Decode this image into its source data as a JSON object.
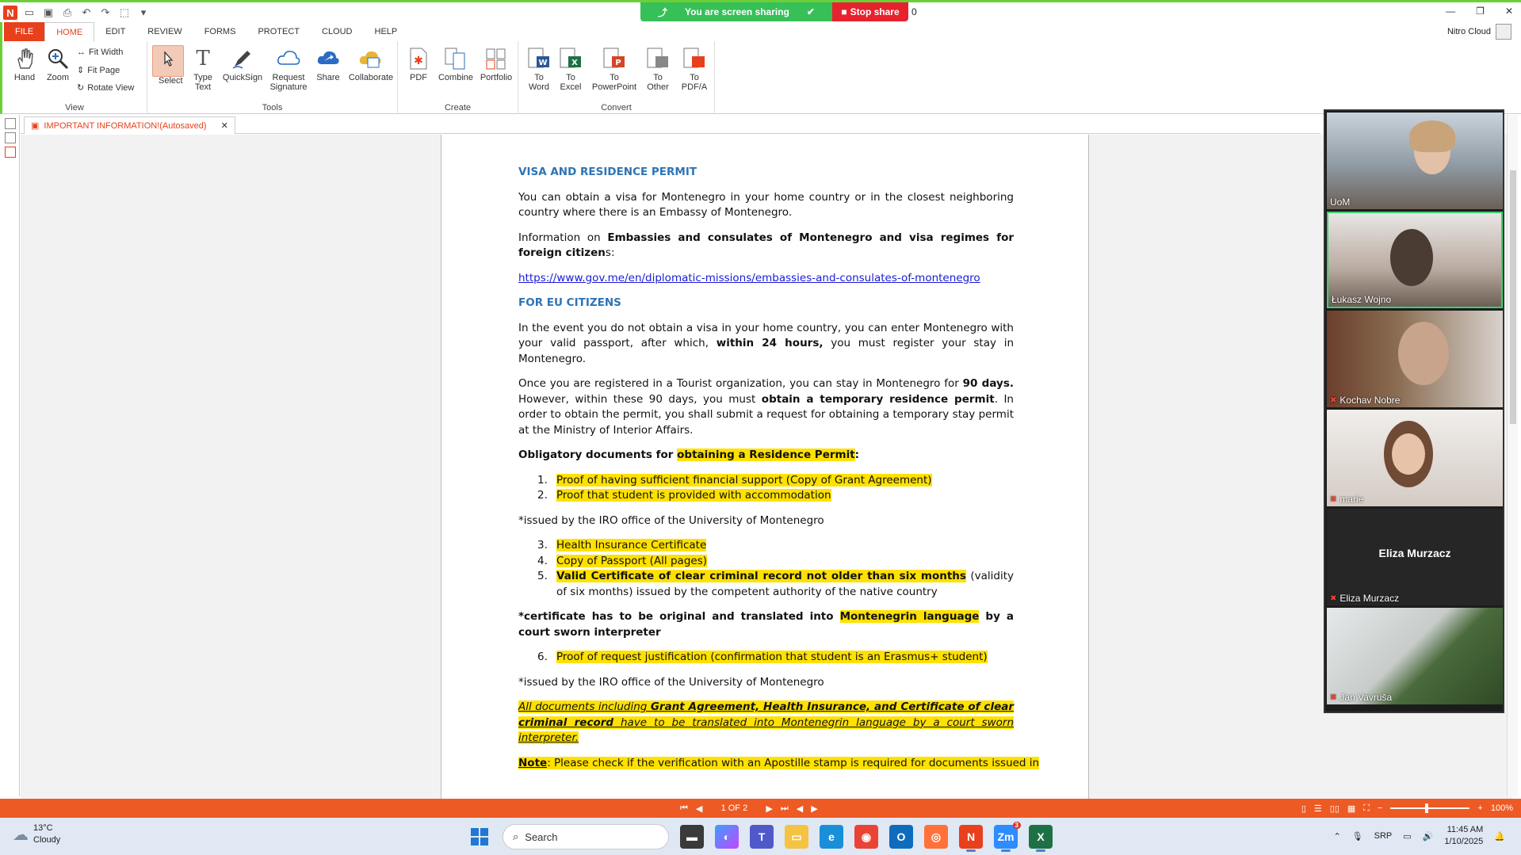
{
  "screen_share": {
    "status": "You are screen sharing",
    "stop_label": "Stop share",
    "count": "0"
  },
  "ribbon_tabs": [
    "FILE",
    "HOME",
    "EDIT",
    "REVIEW",
    "FORMS",
    "PROTECT",
    "CLOUD",
    "HELP"
  ],
  "account": {
    "label": "Nitro Cloud"
  },
  "ribbon": {
    "view": {
      "label": "View",
      "hand": "Hand",
      "zoom": "Zoom",
      "fit_width": "Fit Width",
      "fit_page": "Fit Page",
      "rotate_view": "Rotate View"
    },
    "tools": {
      "label": "Tools",
      "select": "Select",
      "type_text_1": "Type",
      "type_text_2": "Text",
      "quicksign": "QuickSign",
      "request_sig_1": "Request",
      "request_sig_2": "Signature",
      "share": "Share",
      "collaborate": "Collaborate"
    },
    "create": {
      "label": "Create",
      "pdf": "PDF",
      "combine": "Combine",
      "portfolio": "Portfolio"
    },
    "convert": {
      "label": "Convert",
      "to": "To",
      "word": "Word",
      "excel": "Excel",
      "powerpoint": "PowerPoint",
      "other": "Other",
      "pdfa": "PDF/A"
    }
  },
  "document": {
    "tab_title": "IMPORTANT INFORMATION!(Autosaved)",
    "heading_visa": "VISA AND RESIDENCE PERMIT",
    "p1": "You can obtain a visa for Montenegro in your home country or in the closest neighboring country where there is an Embassy of Montenegro.",
    "p2_pre": "Information on ",
    "p2_bold": "Embassies and consulates of Montenegro and visa regimes for foreign citizen",
    "p2_post": "s:",
    "link": "https://www.gov.me/en/diplomatic-missions/embassies-and-consulates-of-montenegro",
    "heading_eu": "FOR EU CITIZENS",
    "p3_pre": "In the event you do not obtain a visa in your home country, you can enter Montenegro with your valid passport, after which, ",
    "p3_bold": "within 24 hours,",
    "p3_post": " you must register your stay in Montenegro.",
    "p4_a": "Once you are registered in a Tourist organization, you can stay in Montenegro for ",
    "p4_b": "90 days.",
    "p4_c": " However, within these 90 days, you must ",
    "p4_d": "obtain a temporary residence permit",
    "p4_e": ". In order to obtain the permit, you shall submit a request for obtaining a temporary stay permit at the Ministry of Interior Affairs.",
    "oblig_pre": "Obligatory documents for ",
    "oblig_hl": "obtaining a Residence Permit",
    "oblig_post": ":",
    "items_a": [
      {
        "n": "1.",
        "t": "Proof of having sufficient financial support (Copy of Grant Agreement)"
      },
      {
        "n": "2.",
        "t": "Proof that student is provided with accommodation"
      }
    ],
    "issued_note": "*issued by the IRO office of the University of Montenegro",
    "items_b": [
      {
        "n": "3.",
        "t": "Health Insurance Certificate"
      },
      {
        "n": "4.",
        "t": "Copy of Passport (All pages)"
      }
    ],
    "item5_n": "5.",
    "item5_hl": "Valid Certificate of clear criminal record not older than six months",
    "item5_post": " (validity of six months) issued by the competent authority of the native country",
    "cert_pre": "*certificate has to be original and translated into ",
    "cert_hl": "Montenegrin language",
    "cert_post": " by a court sworn interpreter",
    "item6_n": "6.",
    "item6_t": "Proof of request justification (confirmation that student is an Erasmus+ student)",
    "issued_note_2": "*issued by the IRO office of the University of Montenegro",
    "all_docs_a": "All documents including ",
    "all_docs_b": "Grant Agreement, Health Insurance, and Certificate of clear criminal record",
    "all_docs_c": " have to be translated into Montenegrin language by a court sworn interpreter.",
    "note_b": "Note",
    "note_t": ": Please check if the verification with an Apostille stamp is required for documents issued in"
  },
  "participants": [
    {
      "name": "UoM",
      "muted": false
    },
    {
      "name": "Łukasz Wojno",
      "muted": false,
      "active": true
    },
    {
      "name": "Kochav Nobre",
      "muted": true
    },
    {
      "name": "marie",
      "muted": true
    },
    {
      "name": "Eliza Murzacz",
      "muted": true,
      "no_video": true
    },
    {
      "name": "Jan Vavruša",
      "muted": true
    }
  ],
  "statusbar": {
    "page": "1 OF 2",
    "zoom": "100%"
  },
  "taskbar": {
    "weather_temp": "13°C",
    "weather_desc": "Cloudy",
    "search_placeholder": "Search",
    "lang": "SRP",
    "time": "11:45 AM",
    "date": "1/10/2025",
    "zoom_badge": "3"
  },
  "colors": {
    "accent": "#e8401c",
    "share_green": "#37c057",
    "stop_red": "#e6222d",
    "statusbar": "#ee5a24",
    "highlight": "#ffe100",
    "heading_blue": "#2e74b5"
  }
}
